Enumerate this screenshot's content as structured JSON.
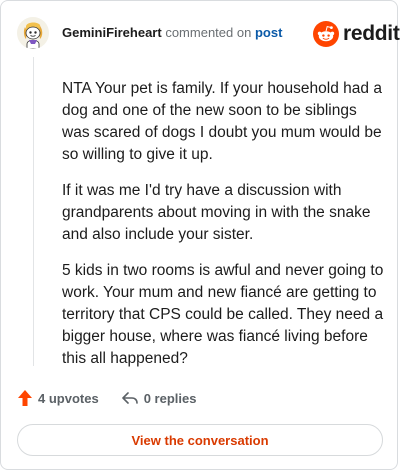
{
  "header": {
    "username": "GeminiFireheart",
    "commented_text": "commented on",
    "post_link": "post"
  },
  "brand": {
    "icon": "reddit-alien-icon",
    "wordmark": "reddit",
    "color": "#ff4500"
  },
  "comment": {
    "paragraphs": [
      "NTA Your pet is family. If your household had a dog and one of the new soon to be siblings was scared of dogs I doubt you mum would be so willing to give it up.",
      "If it was me I'd try have a discussion with grandparents about moving in with the snake and also include your sister.",
      "5 kids in two rooms is awful and never going to work. Your mum and new fiancé are getting to territory that CPS could be called. They need a bigger house, where was fiancé living before this all happened?"
    ]
  },
  "actions": {
    "upvotes_label": "4 upvotes",
    "upvote_icon": "upvote-arrow-icon",
    "upvote_color": "#ff4500",
    "replies_label": "0 replies",
    "reply_icon": "reply-arrow-icon"
  },
  "cta": {
    "label": "View the conversation",
    "color": "#d93a00"
  }
}
